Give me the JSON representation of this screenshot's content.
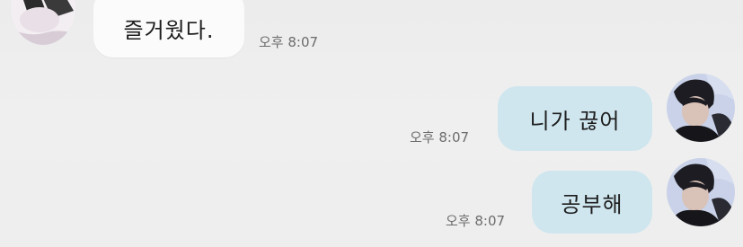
{
  "messages": [
    {
      "direction": "incoming",
      "text": "즐거웠다.",
      "time": "오후 8:07"
    },
    {
      "direction": "outgoing",
      "text": "니가 끊어",
      "time": "오후 8:07"
    },
    {
      "direction": "outgoing",
      "text": "공부해",
      "time": "오후 8:07"
    }
  ],
  "colors": {
    "background": "#eeeeee",
    "incoming_bubble": "#fbfbfb",
    "outgoing_bubble": "#cfe6ef",
    "timestamp": "#6c6c6c"
  }
}
